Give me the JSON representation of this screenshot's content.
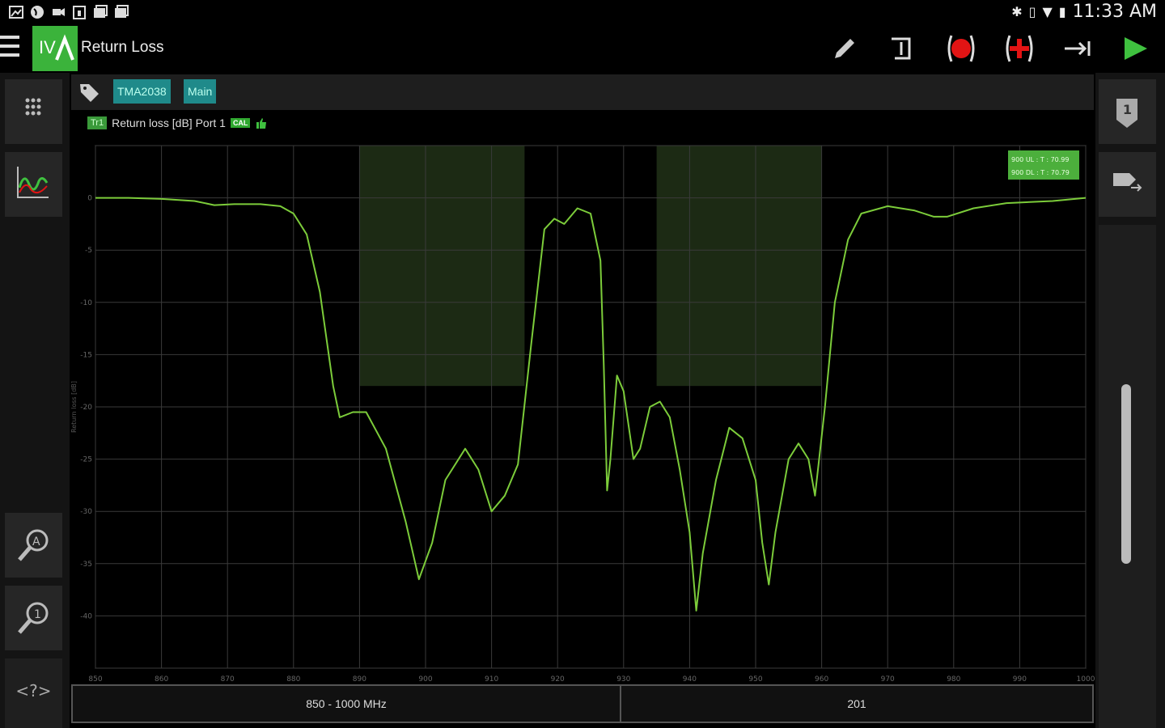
{
  "status_bar": {
    "left_icons": [
      "gallery-icon",
      "globe-icon",
      "cast-icon",
      "calendar-icon",
      "photo-icon",
      "photo-icon-2"
    ],
    "right_icons": [
      "bluetooth-icon",
      "vibrate-icon",
      "signal-icon",
      "battery-icon"
    ],
    "time": "11:33 AM"
  },
  "app_bar": {
    "logo_text": "IV",
    "title": "Return Loss",
    "tools": [
      "edit-icon",
      "hold-icon",
      "record-icon",
      "add-marker-icon",
      "export-icon",
      "play-icon"
    ]
  },
  "tags": [
    "TMA2038",
    "Main"
  ],
  "trace": {
    "badge": "Tr1",
    "label": "Return loss [dB] Port 1",
    "cal_badge": "CAL"
  },
  "legend": [
    "900 UL : T : 70.99",
    "900 DL : T : 70.79"
  ],
  "chart_data": {
    "type": "line",
    "ylabel": "Return loss [dB]",
    "xlim": [
      850,
      1000
    ],
    "ylim": [
      -45,
      5
    ],
    "x_ticks": [
      850,
      860,
      870,
      880,
      890,
      900,
      910,
      920,
      930,
      940,
      950,
      960,
      970,
      980,
      990,
      1000
    ],
    "y_ticks": [
      0,
      -5,
      -10,
      -15,
      -20,
      -25,
      -30,
      -35,
      -40
    ],
    "grid": true,
    "limit_bands": [
      {
        "x": [
          890,
          915
        ],
        "y": [
          -18,
          5
        ]
      },
      {
        "x": [
          935,
          960
        ],
        "y": [
          -18,
          5
        ]
      }
    ],
    "series": [
      {
        "color": "#7ccc3a",
        "points": [
          [
            850,
            0.0
          ],
          [
            855,
            0.0
          ],
          [
            860,
            -0.1
          ],
          [
            865,
            -0.3
          ],
          [
            868,
            -0.7
          ],
          [
            871,
            -0.6
          ],
          [
            875,
            -0.6
          ],
          [
            878,
            -0.8
          ],
          [
            880,
            -1.5
          ],
          [
            882,
            -3.5
          ],
          [
            884,
            -9
          ],
          [
            886,
            -18
          ],
          [
            887,
            -21
          ],
          [
            889,
            -20.5
          ],
          [
            891,
            -20.5
          ],
          [
            894,
            -24
          ],
          [
            897,
            -31
          ],
          [
            899,
            -36.5
          ],
          [
            901,
            -33
          ],
          [
            903,
            -27
          ],
          [
            906,
            -24
          ],
          [
            908,
            -26
          ],
          [
            910,
            -30
          ],
          [
            912,
            -28.5
          ],
          [
            914,
            -25.5
          ],
          [
            916,
            -14
          ],
          [
            918,
            -3
          ],
          [
            919.5,
            -2
          ],
          [
            921,
            -2.5
          ],
          [
            923,
            -1
          ],
          [
            925,
            -1.5
          ],
          [
            926.5,
            -6
          ],
          [
            927,
            -16
          ],
          [
            927.5,
            -28
          ],
          [
            928,
            -25
          ],
          [
            929,
            -17
          ],
          [
            930,
            -18.5
          ],
          [
            931.5,
            -25
          ],
          [
            932.5,
            -24
          ],
          [
            934,
            -20
          ],
          [
            935.5,
            -19.5
          ],
          [
            937,
            -21
          ],
          [
            938.5,
            -26
          ],
          [
            940,
            -32
          ],
          [
            941,
            -39.5
          ],
          [
            942,
            -34
          ],
          [
            944,
            -27
          ],
          [
            946,
            -22
          ],
          [
            948,
            -23
          ],
          [
            950,
            -27
          ],
          [
            951,
            -33
          ],
          [
            952,
            -37
          ],
          [
            953,
            -32
          ],
          [
            955,
            -25
          ],
          [
            956.5,
            -23.5
          ],
          [
            958,
            -25
          ],
          [
            959,
            -28.5
          ],
          [
            960.5,
            -20
          ],
          [
            962,
            -10
          ],
          [
            964,
            -4
          ],
          [
            966,
            -1.5
          ],
          [
            970,
            -0.8
          ],
          [
            974,
            -1.2
          ],
          [
            977,
            -1.8
          ],
          [
            979,
            -1.8
          ],
          [
            983,
            -1
          ],
          [
            988,
            -0.5
          ],
          [
            995,
            -0.3
          ],
          [
            1000,
            0.0
          ]
        ]
      }
    ]
  },
  "left_rail": {
    "buttons": [
      "keypad-icon",
      "trace-icon",
      "marker-a-icon",
      "marker-1-icon"
    ],
    "help_label": "<?>"
  },
  "right_rail": {
    "marker_badge": "1",
    "buttons": [
      "marker-badge-icon",
      "tag-move-icon"
    ]
  },
  "bottom_bar": {
    "range": "850 - 1000 MHz",
    "points": "201"
  }
}
